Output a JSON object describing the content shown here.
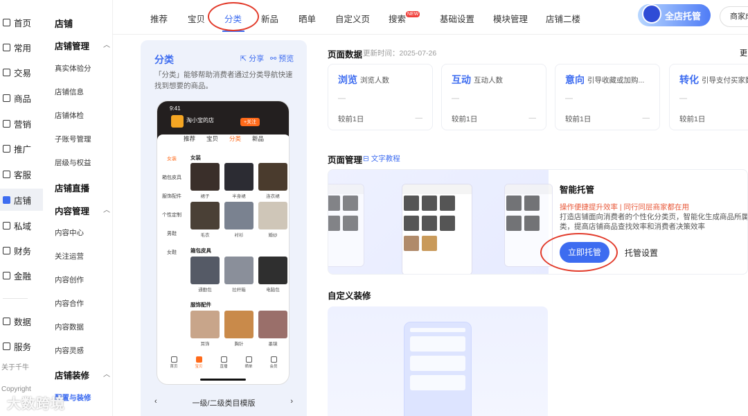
{
  "nav_main": {
    "items": [
      "首页",
      "常用",
      "交易",
      "商品",
      "营销",
      "推广",
      "客服",
      "店铺",
      "私域",
      "财务",
      "金融",
      "数据",
      "服务"
    ],
    "active": "店铺",
    "footer": [
      "关于千牛",
      "Copyright"
    ]
  },
  "nav_shop": {
    "title": "店铺",
    "groups": {
      "manage": {
        "label": "店铺管理",
        "items": [
          "真实体验分",
          "店铺信息",
          "店铺体检",
          "子账号管理",
          "层级与权益"
        ]
      },
      "live": "店铺直播",
      "content": {
        "label": "内容管理",
        "items": [
          "内容中心",
          "关注运营",
          "内容创作",
          "内容合作",
          "内容数据",
          "内容灵感"
        ]
      },
      "decor": {
        "label": "店铺装修",
        "items": [
          "配置与装修"
        ]
      }
    }
  },
  "tabs": {
    "items": [
      "推荐",
      "宝贝",
      "分类",
      "新品",
      "晒单",
      "自定义页",
      "搜索",
      "基础设置",
      "模块管理",
      "店铺二楼"
    ],
    "new_badge": "NEW",
    "selected": "分类"
  },
  "header": {
    "hosting_button": "全店托管",
    "merchant_button": "商家成"
  },
  "config_panel": {
    "title": "分类",
    "share": "分享",
    "preview": "预览",
    "description": "「分类」能够帮助消费者通过分类导航快速找到想要的商品。",
    "template_label": "一级/二级类目模版"
  },
  "phone": {
    "time": "9:41",
    "shop_name": "淘小宝的店",
    "follow": "+关注",
    "tabs": [
      "推荐",
      "宝贝",
      "分类",
      "新品"
    ],
    "selected_tab": "分类",
    "side": [
      "女装",
      "箱包皮具",
      "服饰配件",
      "个性定制",
      "男鞋",
      "女鞋"
    ],
    "sections": [
      {
        "title": "女装",
        "items": [
          "裙子",
          "半身裙",
          "连衣裙",
          "毛衣",
          "衬衫",
          "婚纱"
        ]
      },
      {
        "title": "箱包皮具",
        "items": [
          "通勤包",
          "拉杆箱",
          "电脑包"
        ]
      },
      {
        "title": "服饰配件",
        "items": [
          "耳饰",
          "胸针",
          "墨镜"
        ]
      }
    ],
    "bottom_nav": [
      "首页",
      "宝贝",
      "直播",
      "晒单",
      "会员"
    ],
    "bottom_selected": "宝贝"
  },
  "page_data": {
    "title": "页面数据",
    "update": "更新时间：2025-07-26",
    "more": "更",
    "stats": [
      {
        "key": "浏览",
        "desc": "浏览人数",
        "value": "—",
        "compare": "较前1日",
        "change": "—"
      },
      {
        "key": "互动",
        "desc": "互动人数",
        "value": "—",
        "compare": "较前1日",
        "change": "—"
      },
      {
        "key": "意向",
        "desc": "引导收藏或加购...",
        "value": "—",
        "compare": "较前1日",
        "change": "—"
      },
      {
        "key": "转化",
        "desc": "引导支付买家数",
        "value": "—",
        "compare": "较前1日",
        "change": "—"
      }
    ]
  },
  "page_manage": {
    "title": "页面管理",
    "tutorial": "文字教程",
    "smart_title": "智能托管",
    "highlight": "操作便捷提升效率 | 同行同层商家都在用",
    "desc": "打造店铺面向消费者的个性化分类页，智能化生成商品所属分类，提高店铺商品查找效率和消费者决策效率",
    "start_button": "立即托管",
    "settings": "托管设置"
  },
  "custom": {
    "title": "自定义装修"
  },
  "watermark": "大数跨境",
  "colors": {
    "accent": "#3d6cf0",
    "highlight": "#e8593a",
    "annotation": "#e23a2a",
    "phone_accent": "#ff6a1a"
  }
}
